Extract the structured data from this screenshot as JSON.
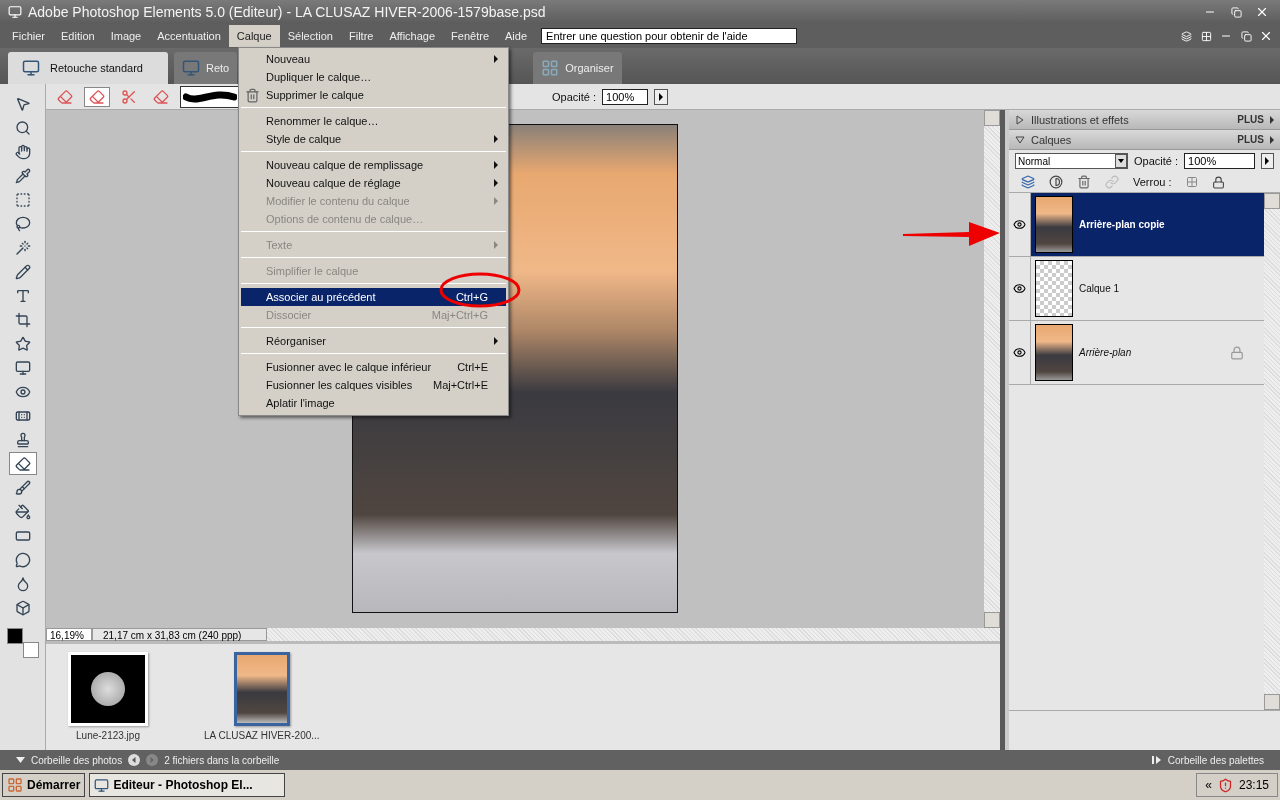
{
  "window": {
    "title": "Adobe Photoshop Elements 5.0 (Editeur) - LA CLUSAZ HIVER-2006-1579base.psd"
  },
  "menu_bar": {
    "items": [
      {
        "label": "Fichier",
        "selected": false
      },
      {
        "label": "Edition",
        "selected": false
      },
      {
        "label": "Image",
        "selected": false
      },
      {
        "label": "Accentuation",
        "selected": false
      },
      {
        "label": "Calque",
        "selected": true
      },
      {
        "label": "Sélection",
        "selected": false
      },
      {
        "label": "Filtre",
        "selected": false
      },
      {
        "label": "Affichage",
        "selected": false
      },
      {
        "label": "Fenêtre",
        "selected": false
      },
      {
        "label": "Aide",
        "selected": false
      }
    ],
    "help_search": {
      "placeholder": "Entrer une question pour obtenir de l'aide"
    }
  },
  "mode_tabs": [
    {
      "label": "Retouche standard",
      "selected": true
    },
    {
      "label": "Reto",
      "selected": false
    },
    {
      "label": "Organiser",
      "selected": false
    }
  ],
  "options_bar": {
    "opacity_label": "Opacité :",
    "opacity_value": "100%"
  },
  "open_menu": {
    "items": [
      {
        "kind": "item",
        "label": "Nouveau",
        "submenu": true,
        "disabled": false,
        "highlighted": false,
        "icon": false
      },
      {
        "kind": "item",
        "label": "Dupliquer le calque…",
        "submenu": false,
        "disabled": false,
        "highlighted": false,
        "icon": false
      },
      {
        "kind": "item",
        "label": "Supprimer le calque",
        "submenu": false,
        "disabled": false,
        "highlighted": false,
        "icon": true
      },
      {
        "kind": "separator"
      },
      {
        "kind": "item",
        "label": "Renommer le calque…",
        "submenu": false,
        "disabled": false,
        "highlighted": false,
        "icon": false
      },
      {
        "kind": "item",
        "label": "Style de calque",
        "submenu": true,
        "disabled": false,
        "highlighted": false,
        "icon": false
      },
      {
        "kind": "separator"
      },
      {
        "kind": "item",
        "label": "Nouveau calque de remplissage",
        "submenu": true,
        "disabled": false,
        "highlighted": false,
        "icon": false
      },
      {
        "kind": "item",
        "label": "Nouveau calque de réglage",
        "submenu": true,
        "disabled": false,
        "highlighted": false,
        "icon": false
      },
      {
        "kind": "item",
        "label": "Modifier le contenu du calque",
        "submenu": true,
        "disabled": true,
        "highlighted": false,
        "icon": false
      },
      {
        "kind": "item",
        "label": "Options de contenu de calque…",
        "submenu": false,
        "disabled": true,
        "highlighted": false,
        "icon": false
      },
      {
        "kind": "separator"
      },
      {
        "kind": "item",
        "label": "Texte",
        "submenu": true,
        "disabled": true,
        "highlighted": false,
        "icon": false
      },
      {
        "kind": "separator"
      },
      {
        "kind": "item",
        "label": "Simplifier le calque",
        "submenu": false,
        "disabled": true,
        "highlighted": false,
        "icon": false
      },
      {
        "kind": "separator"
      },
      {
        "kind": "item",
        "label": "Associer au précédent",
        "shortcut": "Ctrl+G",
        "submenu": false,
        "disabled": false,
        "highlighted": true,
        "icon": false
      },
      {
        "kind": "item",
        "label": "Dissocier",
        "shortcut": "Maj+Ctrl+G",
        "submenu": false,
        "disabled": true,
        "highlighted": false,
        "icon": false
      },
      {
        "kind": "separator"
      },
      {
        "kind": "item",
        "label": "Réorganiser",
        "submenu": true,
        "disabled": false,
        "highlighted": false,
        "icon": false
      },
      {
        "kind": "separator"
      },
      {
        "kind": "item",
        "label": "Fusionner avec le calque inférieur",
        "shortcut": "Ctrl+E",
        "submenu": false,
        "disabled": false,
        "highlighted": false,
        "icon": false
      },
      {
        "kind": "item",
        "label": "Fusionner les calques visibles",
        "shortcut": "Maj+Ctrl+E",
        "submenu": false,
        "disabled": false,
        "highlighted": false,
        "icon": false
      },
      {
        "kind": "item",
        "label": "Aplatir l'image",
        "submenu": false,
        "disabled": false,
        "highlighted": false,
        "icon": false
      }
    ]
  },
  "toolbox": {
    "tools": [
      {
        "selected": false
      },
      {
        "selected": false
      },
      {
        "selected": false
      },
      {
        "selected": false
      },
      {
        "selected": false
      },
      {
        "selected": false
      },
      {
        "selected": false
      },
      {
        "selected": false
      },
      {
        "selected": false
      },
      {
        "selected": false
      },
      {
        "selected": false
      },
      {
        "selected": false
      },
      {
        "selected": false
      },
      {
        "selected": false
      },
      {
        "selected": false
      },
      {
        "selected": true
      },
      {
        "selected": false
      },
      {
        "selected": false
      },
      {
        "selected": false
      },
      {
        "selected": false
      },
      {
        "selected": false
      },
      {
        "selected": false
      }
    ]
  },
  "document": {
    "zoom": "16,19%",
    "info": "21,17 cm x 31,83 cm (240 ppp)"
  },
  "photo_bin": {
    "items": [
      {
        "label": "Lune-2123.jpg",
        "selected": false,
        "kind": "moon"
      },
      {
        "label": "LA CLUSAZ HIVER-200...",
        "selected": true,
        "kind": "photo"
      }
    ],
    "title": "Corbeille des photos",
    "count": "2 fichiers dans la corbeille"
  },
  "palette_bin": {
    "panels": [
      {
        "title": "Illustrations et effets",
        "expanded": false,
        "more": "PLUS"
      },
      {
        "title": "Calques",
        "expanded": true,
        "more": "PLUS"
      }
    ],
    "blend_mode": "Normal",
    "opacity_label": "Opacité :",
    "opacity_value": "100%",
    "lock_label": "Verrou :",
    "layers": [
      {
        "name": "Arrière-plan copie",
        "selected": true,
        "visible": true,
        "locked": false,
        "kind": "photo"
      },
      {
        "name": "Calque 1",
        "selected": false,
        "visible": true,
        "locked": false,
        "kind": "transparent"
      },
      {
        "name": "Arrière-plan",
        "selected": false,
        "visible": true,
        "locked": true,
        "kind": "photo"
      }
    ],
    "footer": "Corbeille des palettes"
  },
  "taskbar": {
    "start": "Démarrer",
    "tasks": [
      {
        "label": "Editeur - Photoshop El...",
        "selected": true
      }
    ],
    "tray_toggle": "«",
    "clock": "23:15"
  }
}
